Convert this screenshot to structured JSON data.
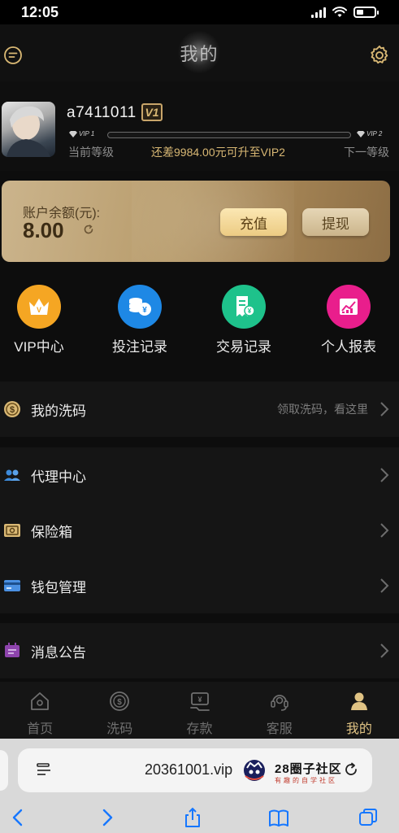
{
  "status_bar": {
    "time": "12:05"
  },
  "header": {
    "title": "我的"
  },
  "profile": {
    "username": "a7411011",
    "vip_badge": "V1",
    "current_level_tag": "VIP 1",
    "next_level_tag": "VIP 2",
    "progress_fraction": 0.0,
    "current_level_label": "当前等级",
    "upgrade_message": "还差9984.00元可升至VIP2",
    "next_level_label": "下一等级"
  },
  "balance": {
    "label": "账户余额(元):",
    "amount": "8.00",
    "recharge_label": "充值",
    "withdraw_label": "提现"
  },
  "quick_actions": [
    {
      "label": "VIP中心",
      "icon": "crown-icon",
      "color": "#f5a623"
    },
    {
      "label": "投注记录",
      "icon": "coin-stack-icon",
      "color": "#1e88e5"
    },
    {
      "label": "交易记录",
      "icon": "receipt-icon",
      "color": "#1ec28b"
    },
    {
      "label": "个人报表",
      "icon": "chart-icon",
      "color": "#e91e8c"
    }
  ],
  "menu": {
    "washcode": {
      "label": "我的洗码",
      "hint": "领取洗码，看这里"
    },
    "agent": {
      "label": "代理中心"
    },
    "safe": {
      "label": "保险箱"
    },
    "wallet": {
      "label": "钱包管理"
    },
    "notice": {
      "label": "消息公告"
    }
  },
  "tabs": [
    {
      "label": "首页",
      "icon": "home-icon"
    },
    {
      "label": "洗码",
      "icon": "dollar-coin-icon"
    },
    {
      "label": "存款",
      "icon": "deposit-icon"
    },
    {
      "label": "客服",
      "icon": "headset-icon"
    },
    {
      "label": "我的",
      "icon": "user-icon",
      "active": true
    }
  ],
  "browser": {
    "url": "20361001.vip",
    "watermark_title": "28圈子社区",
    "watermark_sub": "有趣的自学社区"
  },
  "colors": {
    "gold": "#d9b874",
    "card_gold": "#b89c6c",
    "tab_active": "#e0c384",
    "ios_blue": "#1677ff"
  }
}
